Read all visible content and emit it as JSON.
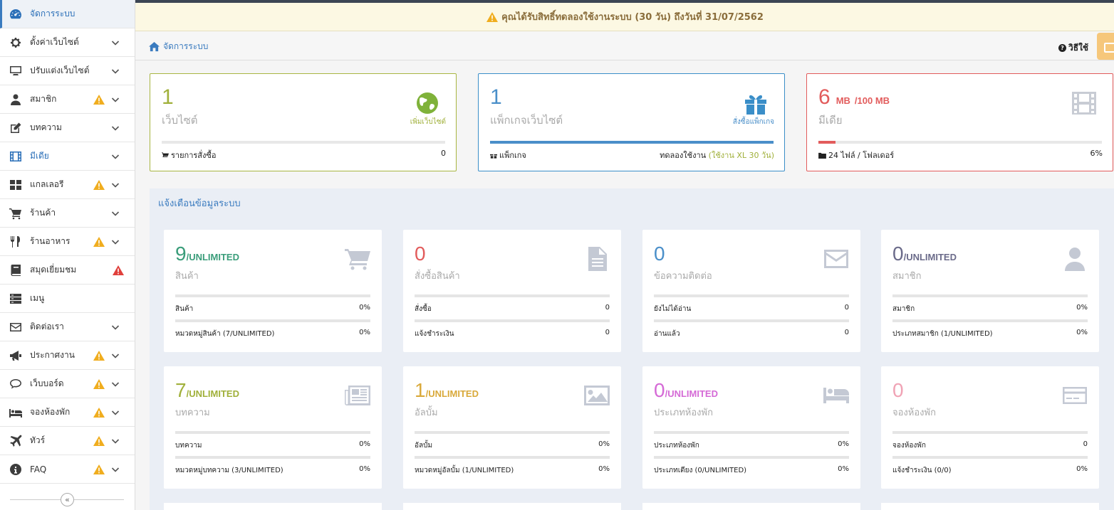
{
  "sidebar": {
    "items": [
      {
        "label": "จัดการระบบ",
        "icon": "dashboard-icon",
        "active": true,
        "warn": false,
        "danger": false,
        "chevron": false
      },
      {
        "label": "ตั้งค่าเว็บไซต์",
        "icon": "gear-icon",
        "warn": false,
        "danger": false,
        "chevron": true
      },
      {
        "label": "ปรับแต่งเว็บไซต์",
        "icon": "monitor-icon",
        "warn": false,
        "danger": false,
        "chevron": true
      },
      {
        "label": "สมาชิก",
        "icon": "user-icon",
        "warn": true,
        "danger": false,
        "chevron": true
      },
      {
        "label": "บทความ",
        "icon": "edit-icon",
        "warn": false,
        "danger": false,
        "chevron": true
      },
      {
        "label": "มีเดีย",
        "icon": "film-icon",
        "warn": false,
        "danger": false,
        "chevron": true,
        "blue": true
      },
      {
        "label": "แกลเลอรี",
        "icon": "grid-icon",
        "warn": true,
        "danger": false,
        "chevron": true
      },
      {
        "label": "ร้านค้า",
        "icon": "cart-icon",
        "warn": false,
        "danger": false,
        "chevron": true
      },
      {
        "label": "ร้านอาหาร",
        "icon": "cutlery-icon",
        "warn": true,
        "danger": false,
        "chevron": true
      },
      {
        "label": "สมุดเยี่ยมชม",
        "icon": "book-icon",
        "warn": false,
        "danger": true,
        "chevron": false
      },
      {
        "label": "เมนู",
        "icon": "menu-icon",
        "warn": false,
        "danger": false,
        "chevron": false
      },
      {
        "label": "ติดต่อเรา",
        "icon": "envelope-icon",
        "warn": false,
        "danger": false,
        "chevron": true
      },
      {
        "label": "ประกาศงาน",
        "icon": "megaphone-icon",
        "warn": true,
        "danger": false,
        "chevron": true
      },
      {
        "label": "เว็บบอร์ด",
        "icon": "comments-icon",
        "warn": true,
        "danger": false,
        "chevron": true
      },
      {
        "label": "จองห้องพัก",
        "icon": "bed-icon",
        "warn": true,
        "danger": false,
        "chevron": true
      },
      {
        "label": "ทัวร์",
        "icon": "plane-icon",
        "warn": true,
        "danger": false,
        "chevron": true
      },
      {
        "label": "FAQ",
        "icon": "info-icon",
        "warn": true,
        "danger": false,
        "chevron": true
      }
    ],
    "collapse_label": "«"
  },
  "banner": {
    "text": "คุณได้รับสิทธิ์ทดลองใช้งานระบบ (30 วัน) ถึงวันที่ 31/07/2562"
  },
  "breadcrumb": {
    "home": "จัดการระบบ"
  },
  "help": {
    "label": "วิธีใช้"
  },
  "summary": [
    {
      "num": "1",
      "unit": "",
      "label": "เว็บไซต์",
      "link": "เพิ่มเว็บไซต์",
      "foot_left": "รายการสั่งซื้อ",
      "foot_right": "0",
      "foot_right_extra": "",
      "color": "#a0b03a",
      "progress": 0
    },
    {
      "num": "1",
      "unit": "",
      "label": "แพ็กเกจเว็บไซต์",
      "link": "สั่งซื้อแพ็กเกจ",
      "foot_left": "แพ็กเกจ",
      "foot_right": "ทดลองใช้งาน",
      "foot_right_extra": "(ใช้งาน XL 30 วัน)",
      "color": "#4a8fc9",
      "progress": 100
    },
    {
      "num": "6",
      "unit": "MB",
      "unit2": "/100 MB",
      "label": "มีเดีย",
      "link": "",
      "foot_left": "24 ไฟล์ / โฟลเดอร์",
      "foot_right": "6%",
      "foot_right_extra": "",
      "color": "#e25c5c",
      "progress": 6
    }
  ],
  "notice": {
    "title": "แจ้งเตือนข้อมูลระบบ"
  },
  "stats": [
    {
      "num": "9",
      "unit": "/UNLIMITED",
      "label": "สินค้า",
      "color": "#3a9d7a",
      "icon": "cart-icon",
      "rows": [
        {
          "l": "สินค้า",
          "r": "0%"
        },
        {
          "l": "หมวดหมู่สินค้า (7/UNLIMITED)",
          "r": "0%"
        }
      ]
    },
    {
      "num": "0",
      "unit": "",
      "label": "สั่งซื้อสินค้า",
      "color": "#e25c5c",
      "icon": "file-icon",
      "rows": [
        {
          "l": "สั่งซื้อ",
          "r": "0"
        },
        {
          "l": "แจ้งชำระเงิน",
          "r": "0"
        }
      ]
    },
    {
      "num": "0",
      "unit": "",
      "label": "ข้อความติดต่อ",
      "color": "#4a8fc9",
      "icon": "envelope-icon",
      "rows": [
        {
          "l": "ยังไม่ได้อ่าน",
          "r": "0"
        },
        {
          "l": "อ่านแล้ว",
          "r": "0"
        }
      ]
    },
    {
      "num": "0",
      "unit": "/UNLIMITED",
      "label": "สมาชิก",
      "color": "#6b6b8a",
      "icon": "user-icon",
      "rows": [
        {
          "l": "สมาชิก",
          "r": "0%"
        },
        {
          "l": "ประเภทสมาชิก (1/UNLIMITED)",
          "r": "0%"
        }
      ]
    },
    {
      "num": "7",
      "unit": "/UNLIMITED",
      "label": "บทความ",
      "color": "#a0b03a",
      "icon": "newspaper-icon",
      "rows": [
        {
          "l": "บทความ",
          "r": "0%"
        },
        {
          "l": "หมวดหมู่บทความ (3/UNLIMITED)",
          "r": "0%"
        }
      ]
    },
    {
      "num": "1",
      "unit": "/UNLIMITED",
      "label": "อัลบั้ม",
      "color": "#d9a93a",
      "icon": "picture-icon",
      "rows": [
        {
          "l": "อัลบั้ม",
          "r": "0%"
        },
        {
          "l": "หมวดหมู่อัลบั้ม (1/UNLIMITED)",
          "r": "0%"
        }
      ]
    },
    {
      "num": "0",
      "unit": "/UNLIMITED",
      "label": "ประเภทห้องพัก",
      "color": "#d56ad6",
      "icon": "bed-icon",
      "rows": [
        {
          "l": "ประเภทห้องพัก",
          "r": "0%"
        },
        {
          "l": "ประเภทเตียง (0/UNLIMITED)",
          "r": "0%"
        }
      ]
    },
    {
      "num": "0",
      "unit": "",
      "label": "จองห้องพัก",
      "color": "#f0a3b5",
      "icon": "card-icon",
      "rows": [
        {
          "l": "จองห้องพัก",
          "r": "0"
        },
        {
          "l": "แจ้งชำระเงิน (0/0)",
          "r": "0%"
        }
      ]
    }
  ]
}
